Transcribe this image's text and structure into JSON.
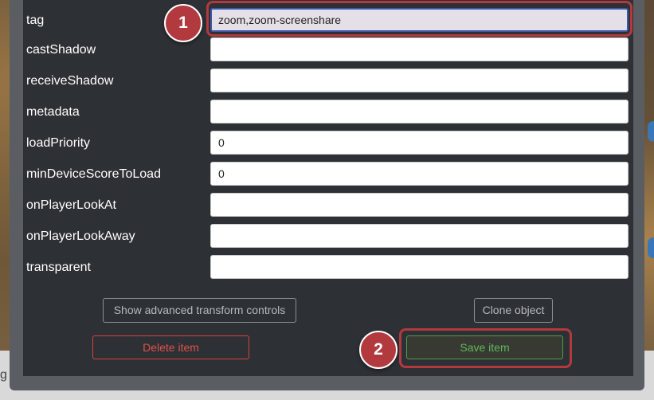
{
  "form": {
    "fields": [
      {
        "label": "tag",
        "value": "zoom,zoom-screenshare"
      },
      {
        "label": "castShadow",
        "value": ""
      },
      {
        "label": "receiveShadow",
        "value": ""
      },
      {
        "label": "metadata",
        "value": ""
      },
      {
        "label": "loadPriority",
        "value": "0"
      },
      {
        "label": "minDeviceScoreToLoad",
        "value": "0"
      },
      {
        "label": "onPlayerLookAt",
        "value": ""
      },
      {
        "label": "onPlayerLookAway",
        "value": ""
      },
      {
        "label": "transparent",
        "value": ""
      }
    ]
  },
  "buttons": {
    "advanced": "Show advanced transform controls",
    "clone": "Clone object",
    "delete": "Delete item",
    "save": "Save item"
  },
  "annotations": {
    "step1": "1",
    "step2": "2"
  },
  "background": {
    "partial_text": "g"
  },
  "colors": {
    "modal_bg": "#2d3035",
    "annotation_red": "#b23a3e",
    "delete_red": "#e0514b",
    "save_green": "#5cb85c",
    "focus_blue": "#3d58a8"
  }
}
